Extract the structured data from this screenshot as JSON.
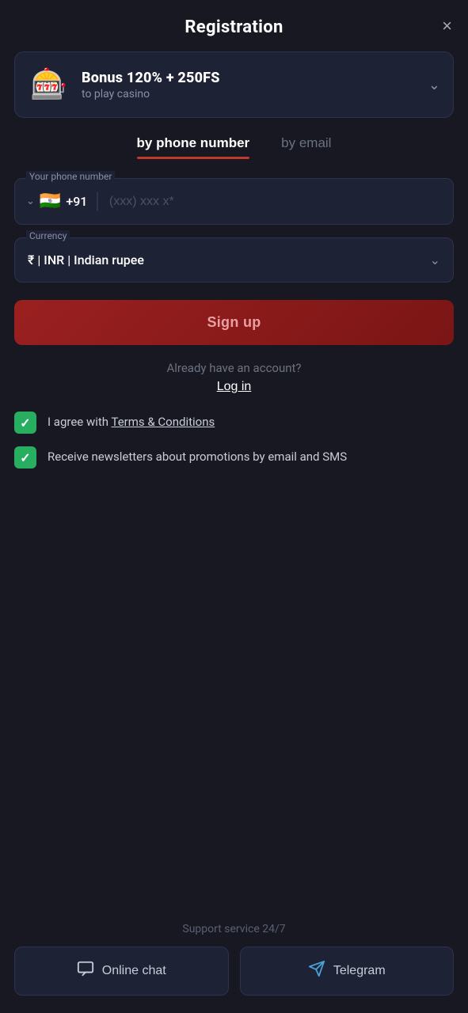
{
  "header": {
    "title": "Registration",
    "close_label": "×"
  },
  "bonus": {
    "icon": "🎰",
    "title": "Bonus 120% + 250FS",
    "subtitle": "to play casino",
    "chevron": "∨"
  },
  "tabs": {
    "phone_label": "by phone number",
    "email_label": "by email"
  },
  "form": {
    "phone_label": "Your phone number",
    "phone_country_code": "+91",
    "phone_placeholder": "(xxx) xxx x*",
    "currency_label": "Currency",
    "currency_value": "₹ | INR | Indian rupee"
  },
  "signup": {
    "button_label": "Sign up"
  },
  "login": {
    "prompt": "Already have an account?",
    "link_label": "Log in"
  },
  "checkboxes": {
    "terms_prefix": "I agree with ",
    "terms_link": "Terms & Conditions",
    "newsletter_label": "Receive newsletters about promotions by email and SMS"
  },
  "support": {
    "label": "Support service 24/7",
    "chat_label": "Online chat",
    "telegram_label": "Telegram",
    "chat_icon": "💬",
    "telegram_icon": "✈"
  }
}
